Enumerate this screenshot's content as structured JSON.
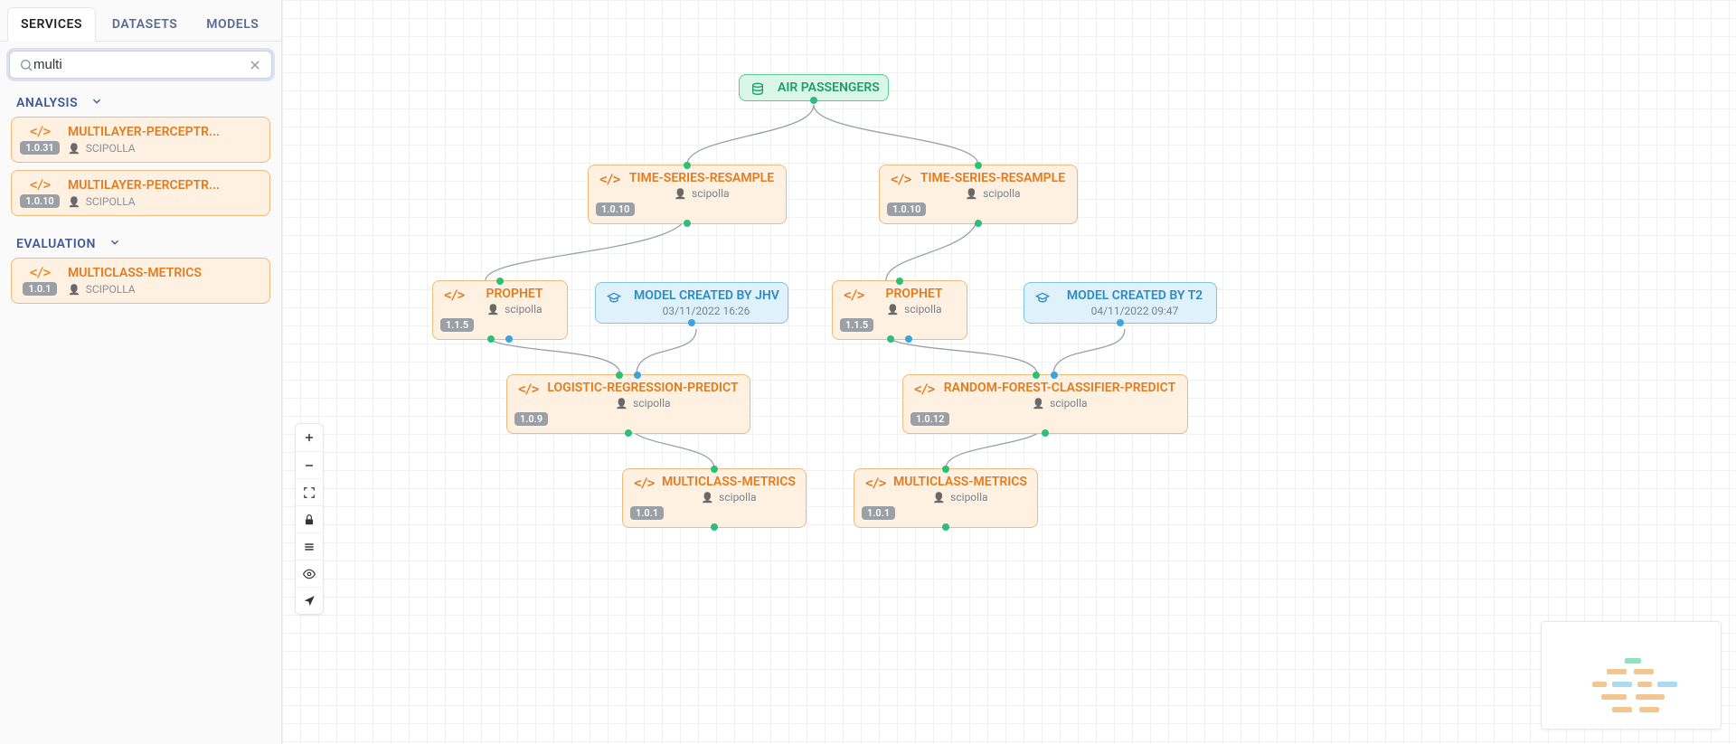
{
  "tabs": {
    "services": "SERVICES",
    "datasets": "DATASETS",
    "models": "MODELS"
  },
  "search": {
    "value": "multi"
  },
  "sections": {
    "analysis": "ANALYSIS",
    "evaluation": "EVALUATION"
  },
  "sidebar_services": {
    "analysis": [
      {
        "name": "MULTILAYER-PERCEPTR...",
        "version": "1.0.31",
        "author": "SCIPOLLA"
      },
      {
        "name": "MULTILAYER-PERCEPTR...",
        "version": "1.0.10",
        "author": "SCIPOLLA"
      }
    ],
    "evaluation": [
      {
        "name": "MULTICLASS-METRICS",
        "version": "1.0.1",
        "author": "SCIPOLLA"
      }
    ]
  },
  "nodes": {
    "air": {
      "type": "dataset",
      "title": "AIR PASSENGERS"
    },
    "ts1": {
      "type": "service",
      "title": "TIME-SERIES-RESAMPLE",
      "version": "1.0.10",
      "author": "scipolla"
    },
    "ts2": {
      "type": "service",
      "title": "TIME-SERIES-RESAMPLE",
      "version": "1.0.10",
      "author": "scipolla"
    },
    "pro1": {
      "type": "service",
      "title": "PROPHET",
      "version": "1.1.5",
      "author": "scipolla"
    },
    "mjhv": {
      "type": "model",
      "title": "MODEL CREATED BY JHV",
      "meta": "03/11/2022 16:26"
    },
    "pro2": {
      "type": "service",
      "title": "PROPHET",
      "version": "1.1.5",
      "author": "scipolla"
    },
    "mt2": {
      "type": "model",
      "title": "MODEL CREATED BY T2",
      "meta": "04/11/2022 09:47"
    },
    "lrp": {
      "type": "service",
      "title": "LOGISTIC-REGRESSION-PREDICT",
      "version": "1.0.9",
      "author": "scipolla"
    },
    "rfc": {
      "type": "service",
      "title": "RANDOM-FOREST-CLASSIFIER-PREDICT",
      "version": "1.0.12",
      "author": "scipolla"
    },
    "mc1": {
      "type": "service",
      "title": "MULTICLASS-METRICS",
      "version": "1.0.1",
      "author": "scipolla"
    },
    "mc2": {
      "type": "service",
      "title": "MULTICLASS-METRICS",
      "version": "1.0.1",
      "author": "scipolla"
    }
  },
  "chart_data": {
    "type": "diagram",
    "title": "Workflow DAG",
    "nodes": [
      {
        "id": "air",
        "label": "AIR PASSENGERS",
        "kind": "dataset"
      },
      {
        "id": "ts1",
        "label": "TIME-SERIES-RESAMPLE",
        "kind": "service",
        "version": "1.0.10",
        "author": "scipolla"
      },
      {
        "id": "ts2",
        "label": "TIME-SERIES-RESAMPLE",
        "kind": "service",
        "version": "1.0.10",
        "author": "scipolla"
      },
      {
        "id": "pro1",
        "label": "PROPHET",
        "kind": "service",
        "version": "1.1.5",
        "author": "scipolla"
      },
      {
        "id": "mjhv",
        "label": "MODEL CREATED BY JHV",
        "kind": "model",
        "meta": "03/11/2022 16:26"
      },
      {
        "id": "pro2",
        "label": "PROPHET",
        "kind": "service",
        "version": "1.1.5",
        "author": "scipolla"
      },
      {
        "id": "mt2",
        "label": "MODEL CREATED BY T2",
        "kind": "model",
        "meta": "04/11/2022 09:47"
      },
      {
        "id": "lrp",
        "label": "LOGISTIC-REGRESSION-PREDICT",
        "kind": "service",
        "version": "1.0.9",
        "author": "scipolla"
      },
      {
        "id": "rfc",
        "label": "RANDOM-FOREST-CLASSIFIER-PREDICT",
        "kind": "service",
        "version": "1.0.12",
        "author": "scipolla"
      },
      {
        "id": "mc1",
        "label": "MULTICLASS-METRICS",
        "kind": "service",
        "version": "1.0.1",
        "author": "scipolla"
      },
      {
        "id": "mc2",
        "label": "MULTICLASS-METRICS",
        "kind": "service",
        "version": "1.0.1",
        "author": "scipolla"
      }
    ],
    "edges": [
      {
        "from": "air",
        "to": "ts1"
      },
      {
        "from": "air",
        "to": "ts2"
      },
      {
        "from": "ts1",
        "to": "pro1"
      },
      {
        "from": "ts2",
        "to": "pro2"
      },
      {
        "from": "pro1",
        "to": "lrp"
      },
      {
        "from": "mjhv",
        "to": "lrp"
      },
      {
        "from": "pro2",
        "to": "rfc"
      },
      {
        "from": "mt2",
        "to": "rfc"
      },
      {
        "from": "lrp",
        "to": "mc1"
      },
      {
        "from": "rfc",
        "to": "mc2"
      }
    ]
  }
}
